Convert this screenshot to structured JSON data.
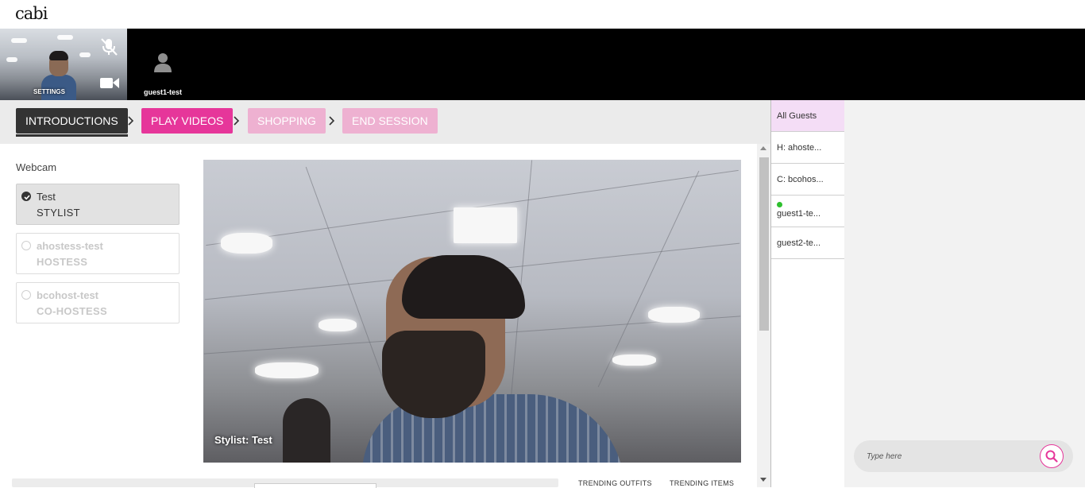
{
  "app": {
    "logo": "cabi"
  },
  "participants": {
    "self": {
      "settings_label": "SETTINGS",
      "icons": [
        "mic-off-icon",
        "video-camera-icon"
      ]
    },
    "guest": {
      "name": "guest1-test",
      "icon": "user-icon"
    }
  },
  "steps": [
    {
      "label": "INTRODUCTIONS",
      "state": "active"
    },
    {
      "label": "PLAY VIDEOS",
      "state": "current"
    },
    {
      "label": "SHOPPING",
      "state": "upcoming"
    },
    {
      "label": "END SESSION",
      "state": "upcoming"
    }
  ],
  "webcam": {
    "label": "Webcam",
    "options": [
      {
        "name": "Test",
        "role": "STYLIST",
        "selected": true
      },
      {
        "name": "ahostess-test",
        "role": "HOSTESS",
        "selected": false
      },
      {
        "name": "bcohost-test",
        "role": "CO-HOSTESS",
        "selected": false
      }
    ]
  },
  "video": {
    "caption": "Stylist: Test"
  },
  "trending": {
    "outfits": "TRENDING OUTFITS",
    "items": "TRENDING ITEMS"
  },
  "guests": [
    {
      "label": "All Guests",
      "active": true,
      "online": false
    },
    {
      "label": "H: ahoste...",
      "active": false,
      "online": false
    },
    {
      "label": "C: bcohos...",
      "active": false,
      "online": false
    },
    {
      "label": "guest1-te...",
      "active": false,
      "online": true
    },
    {
      "label": "guest2-te...",
      "active": false,
      "online": false
    }
  ],
  "chat": {
    "placeholder": "Type here",
    "search_icon": "search-icon"
  },
  "colors": {
    "accent": "#e6369a",
    "accent_light": "#eeb1d1",
    "active_step": "#333333",
    "online": "#2ec02e",
    "selected_guest": "#f4ddf6"
  }
}
